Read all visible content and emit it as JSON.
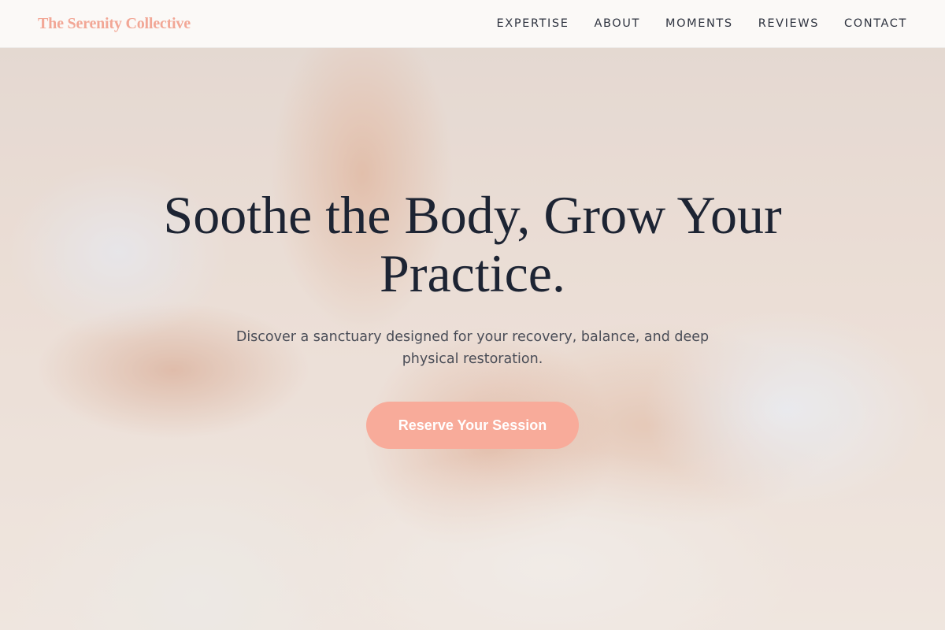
{
  "brand": {
    "name": "The Serenity Collective",
    "color": "#f2a796"
  },
  "nav": {
    "items": [
      {
        "label": "EXPERTISE"
      },
      {
        "label": "ABOUT"
      },
      {
        "label": "MOMENTS"
      },
      {
        "label": "REVIEWS"
      },
      {
        "label": "CONTACT"
      }
    ]
  },
  "hero": {
    "headline": "Soothe the Body, Grow Your Practice.",
    "subtitle": "Discover a sanctuary designed for your recovery, balance, and deep physical restoration.",
    "cta_label": "Reserve Your Session",
    "accent_color": "#f8ab9a"
  }
}
